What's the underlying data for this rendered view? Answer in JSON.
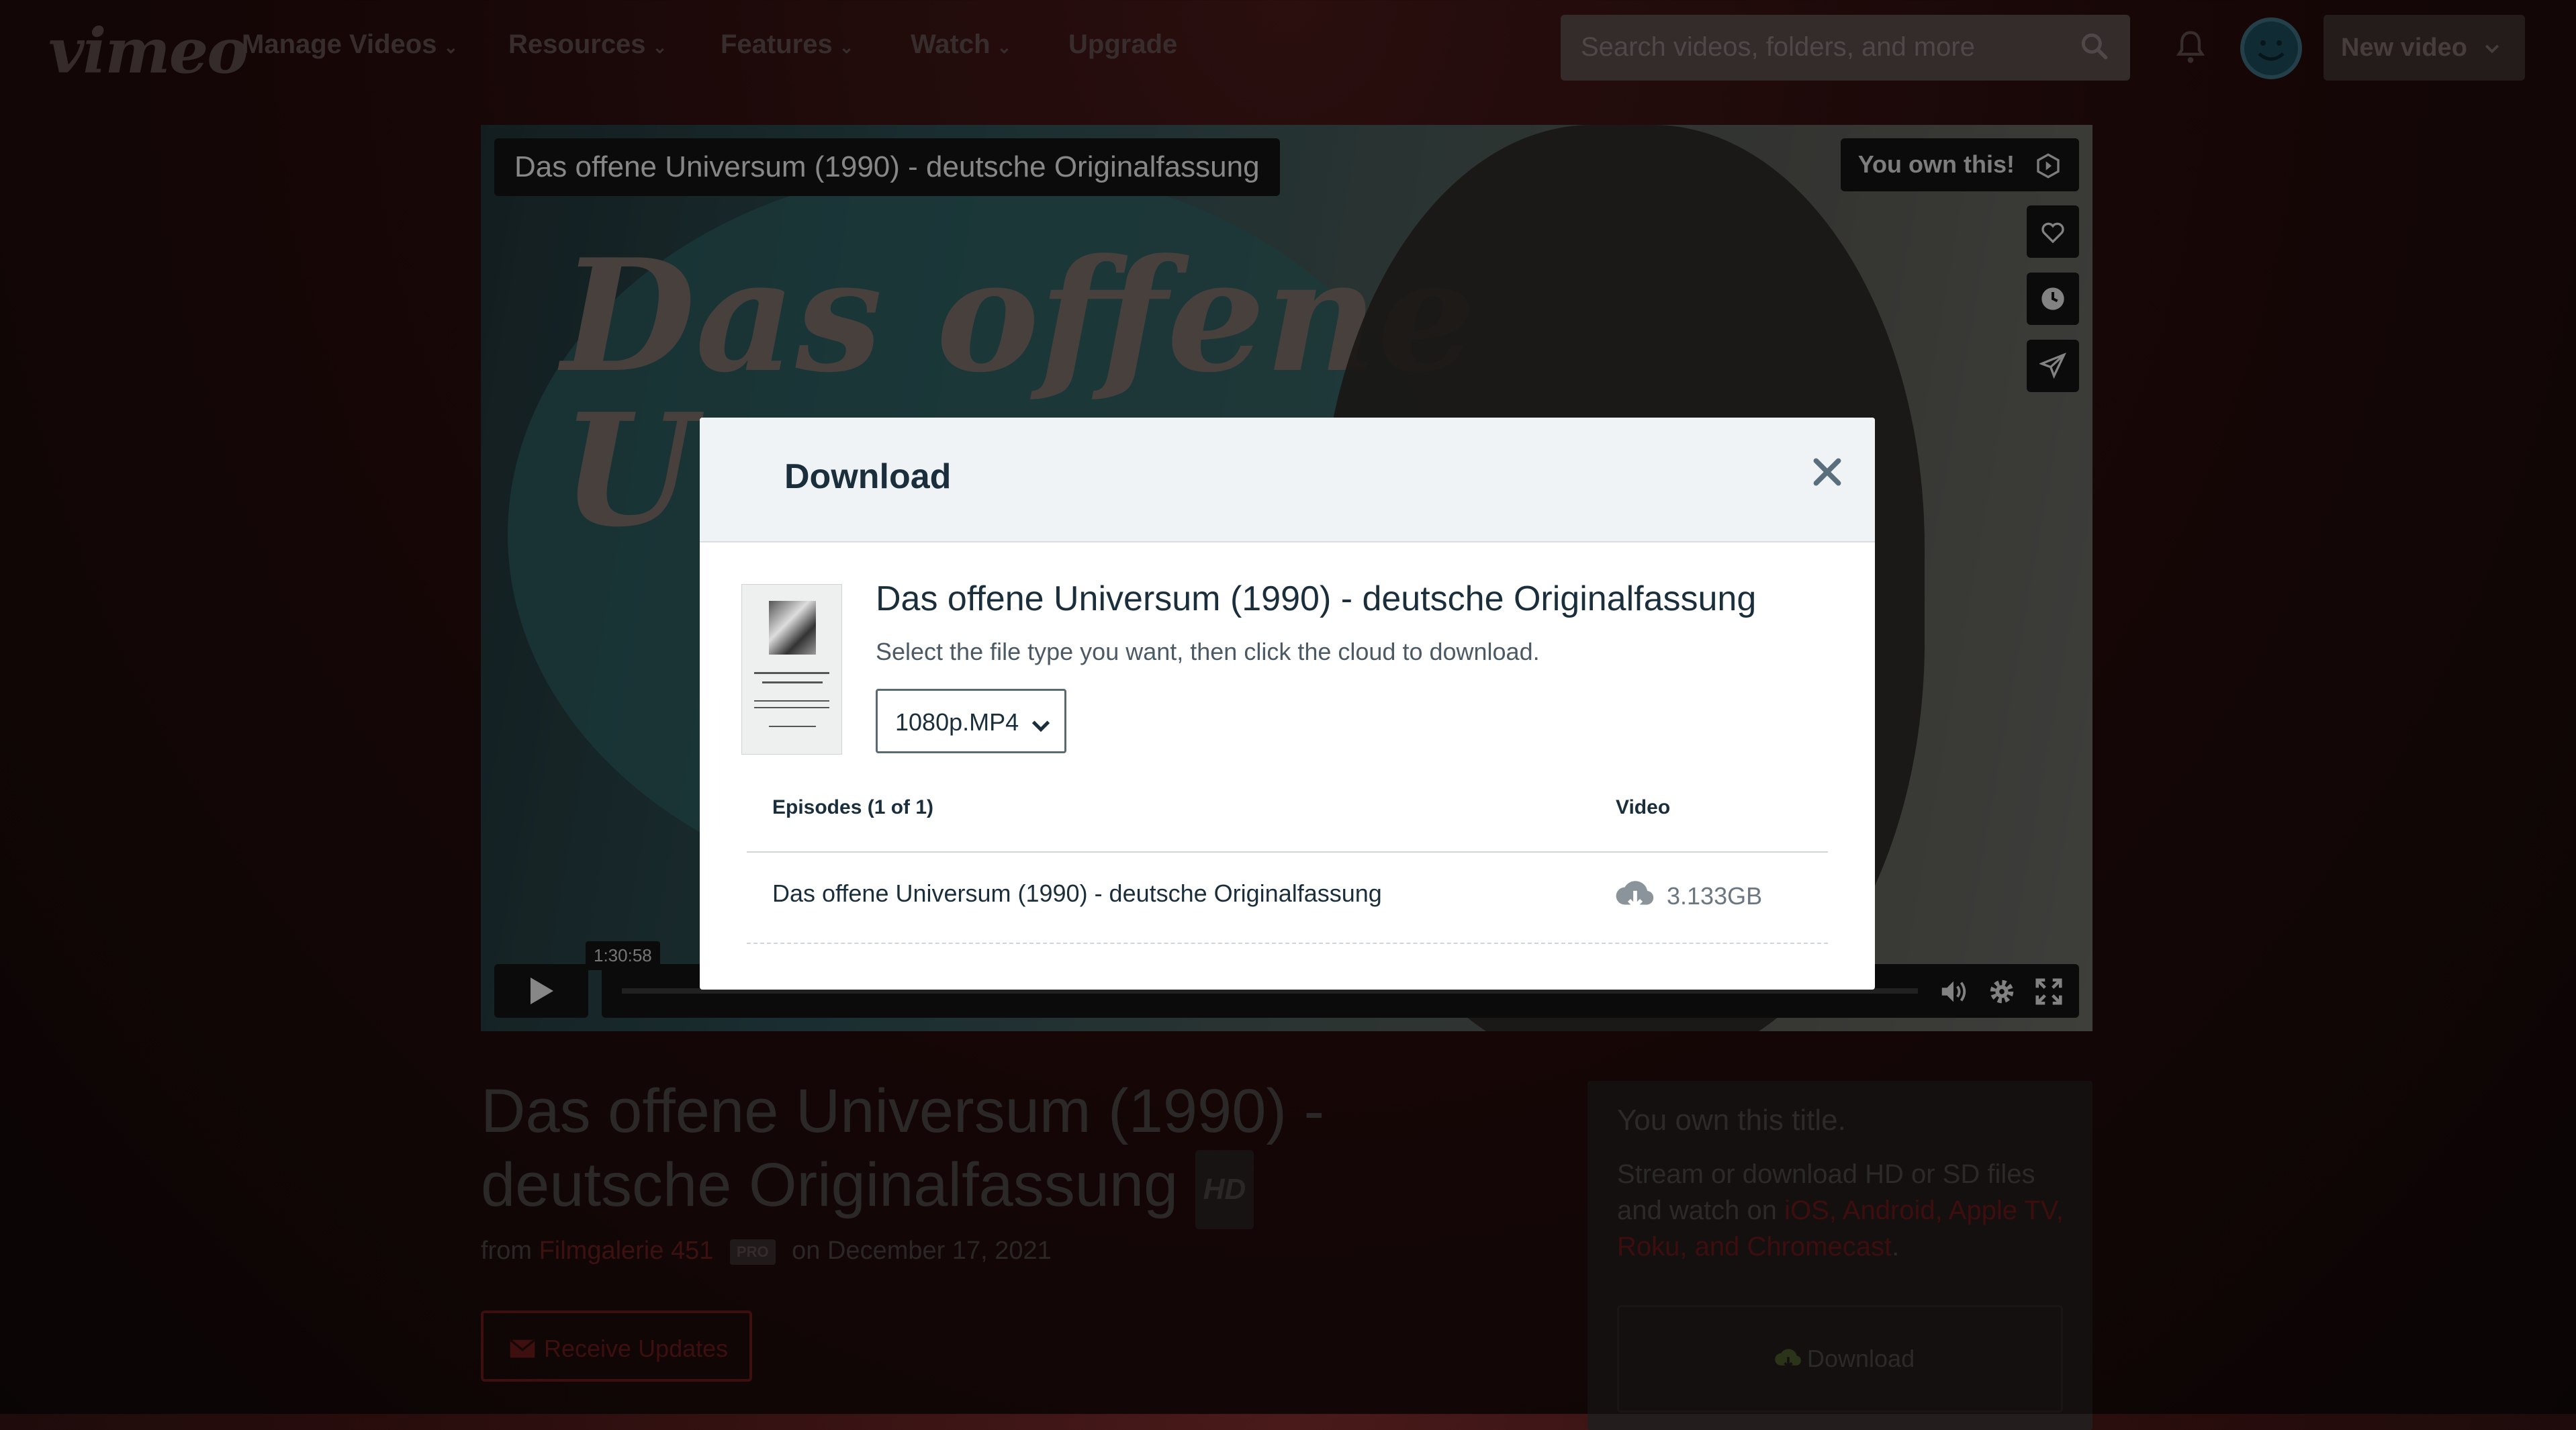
{
  "nav": {
    "logo": "vimeo",
    "items": [
      {
        "label": "Manage Videos",
        "chevron": true
      },
      {
        "label": "Resources",
        "chevron": true
      },
      {
        "label": "Features",
        "chevron": true
      },
      {
        "label": "Watch",
        "chevron": true
      },
      {
        "label": "Upgrade",
        "chevron": false
      }
    ],
    "search_placeholder": "Search videos, folders, and more",
    "new_video_label": "New video"
  },
  "player": {
    "title": "Das offene Universum (1990) - deutsche Originalfassung",
    "poster_text_line1": "Das offene",
    "poster_text_line2": "Un",
    "own_tag": "You own this!",
    "hover_time": "1:30:58"
  },
  "page": {
    "title_line1": "Das offene Universum (1990) -",
    "title_line2": "deutsche Originalfassung",
    "hd_badge": "HD",
    "from_label": "from",
    "channel": "Filmgalerie 451",
    "pro_badge": "PRO",
    "date_text": "on December 17, 2021",
    "receive_updates": "Receive Updates"
  },
  "own_box": {
    "heading": "You own this title.",
    "text_before": "Stream or download HD or SD files and watch on ",
    "platforms": "iOS, Android, Apple TV, Roku, and Chromecast",
    "text_after": ".",
    "download_label": "Download"
  },
  "modal": {
    "title": "Download",
    "video_title": "Das offene Universum (1990) - deutsche Originalfassung",
    "instructions": "Select the file type you want, then click the cloud to download.",
    "file_type": "1080p.MP4",
    "columns": {
      "episodes": "Episodes (1 of 1)",
      "video": "Video"
    },
    "rows": [
      {
        "episode": "Das offene Universum (1990) - deutsche Originalfassung",
        "size": "3.133GB"
      }
    ]
  },
  "colors": {
    "accent_red": "#c8202a",
    "modal_header": "#f0f3f5",
    "text_dark": "#1a2e3b"
  }
}
